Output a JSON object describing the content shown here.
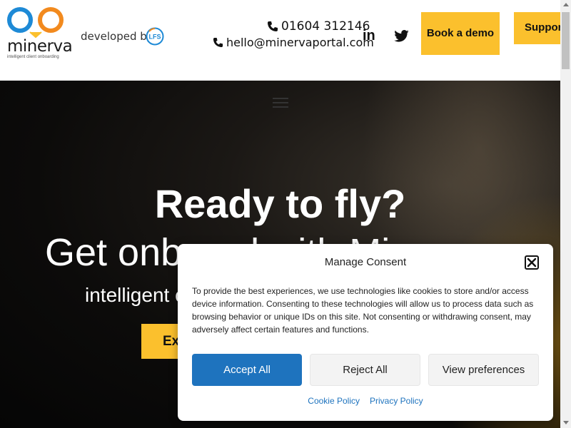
{
  "header": {
    "logo_text": "minerva",
    "logo_tagline": "intelligent client onboarding",
    "developed_by": "developed by",
    "partner_logo": "LFS",
    "phone": "01604 312146",
    "email": "hello@minervaportal.com",
    "social": [
      {
        "icon": "linkedin-icon",
        "label": "in"
      },
      {
        "icon": "twitter-icon",
        "label": ""
      }
    ],
    "book_demo_label": "Book a demo",
    "support_label": "Support"
  },
  "hero": {
    "title": "Ready to fly?",
    "subtitle": "Get onboard with Minerva",
    "line3": "intelligent client onboarding",
    "cta_label": "Explore"
  },
  "consent": {
    "title": "Manage Consent",
    "body": "To provide the best experiences, we use technologies like cookies to store and/or access device information. Consenting to these technologies will allow us to process data such as browsing behavior or unique IDs on this site. Not consenting or withdrawing consent, may adversely affect certain features and functions.",
    "accept_label": "Accept All",
    "reject_label": "Reject All",
    "prefs_label": "View preferences",
    "links": [
      "Cookie Policy",
      "Privacy Policy"
    ]
  },
  "colors": {
    "accent_yellow": "#fbc02d",
    "brand_blue": "#1e8ad6",
    "brand_orange": "#f28a1e",
    "consent_blue": "#1e73be"
  }
}
